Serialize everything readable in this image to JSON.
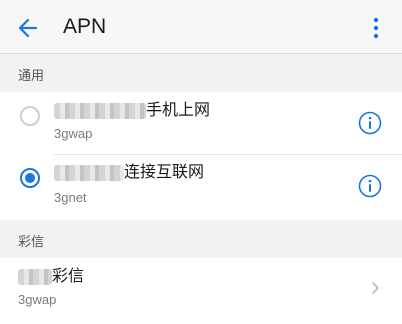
{
  "header": {
    "title": "APN",
    "back_icon": "arrow-left-icon",
    "more_icon": "more-vertical-icon",
    "accent": "#1a73e8"
  },
  "sections": [
    {
      "label": "通用",
      "items": [
        {
          "title_suffix": "手机上网",
          "subtitle": "3gwap",
          "selected": false,
          "action_icon": "info-icon"
        },
        {
          "title_suffix": "连接互联网",
          "subtitle": "3gnet",
          "selected": true,
          "action_icon": "info-icon"
        }
      ]
    },
    {
      "label": "彩信",
      "items": [
        {
          "title_suffix": "彩信",
          "subtitle": "3gwap",
          "action_icon": "chevron-right-icon"
        }
      ]
    }
  ]
}
